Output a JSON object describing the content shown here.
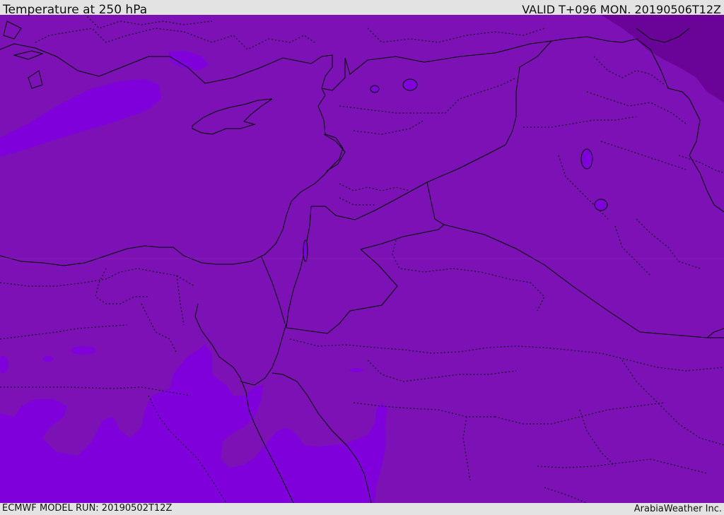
{
  "header": {
    "title": "Temperature at 250 hPa",
    "valid": "VALID T+096 MON. 20190506T12Z"
  },
  "footer": {
    "model_run": "ECMWF MODEL RUN: 20190502T12Z",
    "credit": "ArabiaWeather Inc."
  },
  "map": {
    "variable": "Temperature",
    "level": "250 hPa",
    "colors": {
      "base_fill": "#7c12b5",
      "warm_fill": "#8000dc",
      "cold_fill": "#6a0499",
      "coastline": "#000000",
      "borders": "#000000"
    }
  }
}
